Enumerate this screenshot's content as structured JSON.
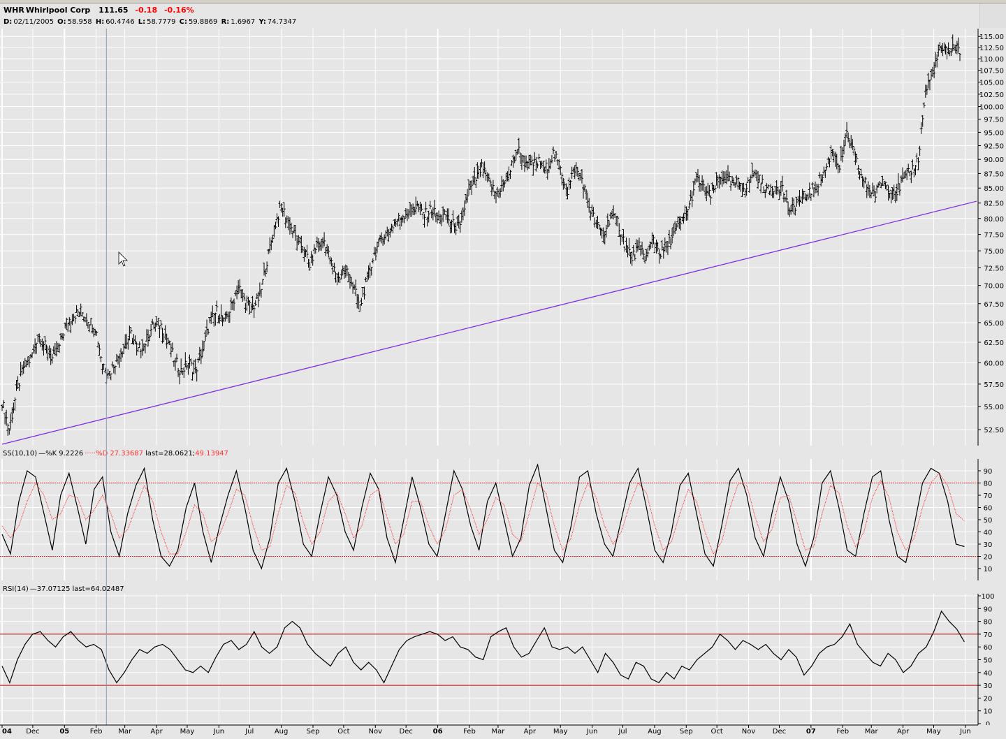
{
  "header": {
    "symbol": "WHR",
    "name": "Whirlpool Corp",
    "last": "111.65",
    "change": "-0.18",
    "change_pct": "-0.16%"
  },
  "ohlc": {
    "date_label": "D:",
    "date": "02/11/2005",
    "open_label": "O:",
    "open": "58.958",
    "high_label": "H:",
    "high": "60.4746",
    "low_label": "L:",
    "low": "58.7779",
    "close_label": "C:",
    "close": "59.8869",
    "range_label": "R:",
    "range": "1.6967",
    "y_label": "Y:",
    "y": "74.7347"
  },
  "stoch_header": {
    "name": "SS(10,10)",
    "k_label": "%K",
    "k_value": "9.2226",
    "d_label": "%D",
    "d_value": "27.33687",
    "last_label": "last=",
    "last_value": "28.0621;",
    "last_d_value": "49.13947"
  },
  "rsi_header": {
    "name": "RSI(14)",
    "value": "37.07125",
    "last_label": "last=",
    "last_value": "64.02487"
  },
  "colors": {
    "background": "#e6e6e6",
    "grid": "#ffffff",
    "price": "#000000",
    "trendline": "#7f2fdf",
    "d_line": "#ff3030",
    "rsi_band": "#c00000",
    "stoch_band": "#d02020",
    "cursor_line": "#8c9cb4"
  },
  "chart_data": [
    {
      "type": "ohlc",
      "title": "WHR Whirlpool Corp",
      "y_ticks": [
        52.5,
        55.0,
        57.5,
        60.0,
        62.5,
        65.0,
        67.5,
        70.0,
        72.5,
        75.0,
        77.5,
        80.0,
        82.5,
        85.0,
        87.5,
        90.0,
        92.5,
        95.0,
        97.5,
        100.0,
        102.5,
        105.0,
        107.5,
        110.0,
        112.5,
        115.0
      ],
      "scale": "log",
      "ylim": [
        51.0,
        116.0
      ],
      "x_labels": [
        "04",
        "Dec",
        "05",
        "Feb",
        "Mar",
        "Apr",
        "May",
        "Jun",
        "Jul",
        "Aug",
        "Sep",
        "Oct",
        "Nov",
        "Dec",
        "06",
        "Feb",
        "Mar",
        "Apr",
        "May",
        "Jun",
        "Jul",
        "Aug",
        "Sep",
        "Oct",
        "Nov",
        "Dec",
        "07",
        "Feb",
        "Mar",
        "Apr",
        "May",
        "Jun"
      ],
      "year_labels": [
        "04",
        "05",
        "06",
        "07"
      ],
      "series_close": [
        [
          "2004-11-01",
          55.5
        ],
        [
          "2004-11-08",
          52.5
        ],
        [
          "2004-11-15",
          56.5
        ],
        [
          "2004-11-22",
          59.5
        ],
        [
          "2004-11-29",
          60.5
        ],
        [
          "2004-12-06",
          63.5
        ],
        [
          "2004-12-13",
          62.0
        ],
        [
          "2004-12-20",
          60.5
        ],
        [
          "2004-12-27",
          62.0
        ],
        [
          "2005-01-03",
          65.0
        ],
        [
          "2005-01-10",
          66.0
        ],
        [
          "2005-01-17",
          66.5
        ],
        [
          "2005-01-24",
          65.5
        ],
        [
          "2005-01-31",
          64.5
        ],
        [
          "2005-02-07",
          60.0
        ],
        [
          "2005-02-14",
          58.8
        ],
        [
          "2005-02-21",
          60.5
        ],
        [
          "2005-02-28",
          62.0
        ],
        [
          "2005-03-07",
          63.5
        ],
        [
          "2005-03-14",
          61.5
        ],
        [
          "2005-03-21",
          62.5
        ],
        [
          "2005-03-28",
          64.5
        ],
        [
          "2005-04-04",
          65.0
        ],
        [
          "2005-04-11",
          63.0
        ],
        [
          "2005-04-18",
          60.5
        ],
        [
          "2005-04-25",
          59.0
        ],
        [
          "2005-05-02",
          60.0
        ],
        [
          "2005-05-09",
          59.0
        ],
        [
          "2005-05-16",
          61.5
        ],
        [
          "2005-05-23",
          65.0
        ],
        [
          "2005-05-30",
          66.5
        ],
        [
          "2005-06-06",
          65.0
        ],
        [
          "2005-06-13",
          67.0
        ],
        [
          "2005-06-20",
          70.0
        ],
        [
          "2005-06-27",
          67.5
        ],
        [
          "2005-07-04",
          67.0
        ],
        [
          "2005-07-11",
          68.5
        ],
        [
          "2005-07-18",
          73.5
        ],
        [
          "2005-07-25",
          78.5
        ],
        [
          "2005-08-01",
          82.0
        ],
        [
          "2005-08-08",
          79.5
        ],
        [
          "2005-08-15",
          77.0
        ],
        [
          "2005-08-22",
          75.5
        ],
        [
          "2005-08-29",
          73.0
        ],
        [
          "2005-09-05",
          76.0
        ],
        [
          "2005-09-12",
          76.5
        ],
        [
          "2005-09-19",
          73.0
        ],
        [
          "2005-09-26",
          71.0
        ],
        [
          "2005-10-03",
          72.5
        ],
        [
          "2005-10-10",
          70.0
        ],
        [
          "2005-10-17",
          67.0
        ],
        [
          "2005-10-24",
          71.0
        ],
        [
          "2005-10-31",
          74.5
        ],
        [
          "2005-11-07",
          77.0
        ],
        [
          "2005-11-14",
          78.0
        ],
        [
          "2005-11-21",
          79.5
        ],
        [
          "2005-11-28",
          80.5
        ],
        [
          "2005-12-05",
          81.5
        ],
        [
          "2005-12-12",
          82.0
        ],
        [
          "2005-12-19",
          80.5
        ],
        [
          "2005-12-26",
          81.5
        ],
        [
          "2006-01-02",
          80.0
        ],
        [
          "2006-01-09",
          80.5
        ],
        [
          "2006-01-16",
          79.0
        ],
        [
          "2006-01-23",
          78.5
        ],
        [
          "2006-01-30",
          84.0
        ],
        [
          "2006-02-06",
          86.0
        ],
        [
          "2006-02-13",
          88.5
        ],
        [
          "2006-02-20",
          86.0
        ],
        [
          "2006-02-27",
          84.0
        ],
        [
          "2006-03-06",
          85.5
        ],
        [
          "2006-03-13",
          88.0
        ],
        [
          "2006-03-20",
          92.0
        ],
        [
          "2006-03-27",
          89.5
        ],
        [
          "2006-04-03",
          89.0
        ],
        [
          "2006-04-10",
          89.5
        ],
        [
          "2006-04-17",
          88.5
        ],
        [
          "2006-04-24",
          91.0
        ],
        [
          "2006-05-01",
          88.5
        ],
        [
          "2006-05-08",
          84.5
        ],
        [
          "2006-05-15",
          88.5
        ],
        [
          "2006-05-22",
          86.5
        ],
        [
          "2006-05-29",
          82.0
        ],
        [
          "2006-06-05",
          79.0
        ],
        [
          "2006-06-12",
          77.5
        ],
        [
          "2006-06-19",
          80.5
        ],
        [
          "2006-06-26",
          79.5
        ],
        [
          "2006-07-03",
          76.0
        ],
        [
          "2006-07-10",
          74.0
        ],
        [
          "2006-07-17",
          75.5
        ],
        [
          "2006-07-24",
          74.0
        ],
        [
          "2006-07-31",
          77.0
        ],
        [
          "2006-08-07",
          74.5
        ],
        [
          "2006-08-14",
          76.0
        ],
        [
          "2006-08-21",
          78.0
        ],
        [
          "2006-08-28",
          79.5
        ],
        [
          "2006-09-04",
          82.0
        ],
        [
          "2006-09-11",
          86.5
        ],
        [
          "2006-09-18",
          85.0
        ],
        [
          "2006-09-25",
          83.5
        ],
        [
          "2006-10-02",
          86.5
        ],
        [
          "2006-10-09",
          87.0
        ],
        [
          "2006-10-16",
          85.5
        ],
        [
          "2006-10-23",
          86.0
        ],
        [
          "2006-10-30",
          85.0
        ],
        [
          "2006-11-06",
          88.0
        ],
        [
          "2006-11-13",
          86.0
        ],
        [
          "2006-11-20",
          84.5
        ],
        [
          "2006-11-27",
          85.5
        ],
        [
          "2006-12-04",
          85.0
        ],
        [
          "2006-12-11",
          81.0
        ],
        [
          "2006-12-18",
          82.5
        ],
        [
          "2006-12-25",
          83.5
        ],
        [
          "2007-01-01",
          84.5
        ],
        [
          "2007-01-08",
          86.0
        ],
        [
          "2007-01-15",
          88.0
        ],
        [
          "2007-01-22",
          92.0
        ],
        [
          "2007-01-29",
          88.5
        ],
        [
          "2007-02-05",
          94.5
        ],
        [
          "2007-02-12",
          91.0
        ],
        [
          "2007-02-19",
          87.0
        ],
        [
          "2007-02-26",
          85.0
        ],
        [
          "2007-03-05",
          84.0
        ],
        [
          "2007-03-12",
          86.5
        ],
        [
          "2007-03-19",
          85.0
        ],
        [
          "2007-03-26",
          84.5
        ],
        [
          "2007-04-02",
          86.5
        ],
        [
          "2007-04-09",
          88.0
        ],
        [
          "2007-04-16",
          90.0
        ],
        [
          "2007-04-23",
          103.0
        ],
        [
          "2007-04-30",
          107.0
        ],
        [
          "2007-05-07",
          112.0
        ],
        [
          "2007-05-14",
          111.5
        ],
        [
          "2007-05-21",
          113.0
        ],
        [
          "2007-05-28",
          111.65
        ]
      ],
      "trendline": {
        "from": [
          "2004-11-01",
          51.0
        ],
        "to": [
          "2007-06-12",
          82.8
        ]
      }
    },
    {
      "type": "line",
      "title": "SS(10,10)",
      "y_ticks": [
        10,
        20,
        30,
        40,
        50,
        60,
        70,
        80,
        90
      ],
      "ylim": [
        2,
        98
      ],
      "bands": [
        20,
        80
      ],
      "series": [
        {
          "name": "%K",
          "values": [
            38,
            22,
            65,
            90,
            85,
            55,
            25,
            70,
            88,
            60,
            30,
            75,
            85,
            40,
            20,
            55,
            78,
            92,
            50,
            20,
            12,
            25,
            60,
            80,
            40,
            15,
            45,
            70,
            90,
            60,
            25,
            10,
            35,
            80,
            92,
            65,
            30,
            20,
            55,
            85,
            70,
            40,
            25,
            60,
            88,
            75,
            35,
            15,
            50,
            85,
            60,
            30,
            20,
            55,
            90,
            75,
            45,
            25,
            65,
            80,
            50,
            20,
            35,
            78,
            95,
            60,
            25,
            15,
            45,
            85,
            90,
            55,
            30,
            20,
            50,
            80,
            92,
            60,
            25,
            15,
            40,
            78,
            88,
            55,
            22,
            12,
            45,
            82,
            92,
            70,
            35,
            20,
            55,
            85,
            65,
            30,
            12,
            35,
            80,
            90,
            60,
            25,
            20,
            55,
            85,
            90,
            50,
            20,
            15,
            45,
            80,
            92,
            88,
            65,
            30,
            28
          ]
        },
        {
          "name": "%D",
          "values": [
            45,
            35,
            45,
            65,
            80,
            70,
            50,
            55,
            70,
            68,
            50,
            58,
            70,
            55,
            35,
            42,
            60,
            78,
            65,
            40,
            22,
            22,
            40,
            62,
            55,
            32,
            38,
            55,
            75,
            70,
            45,
            25,
            28,
            55,
            78,
            72,
            48,
            30,
            40,
            65,
            72,
            55,
            35,
            45,
            70,
            75,
            52,
            30,
            38,
            65,
            65,
            45,
            30,
            42,
            70,
            75,
            58,
            38,
            50,
            68,
            62,
            38,
            32,
            55,
            80,
            72,
            45,
            25,
            35,
            62,
            80,
            68,
            45,
            30,
            40,
            62,
            80,
            72,
            45,
            25,
            32,
            55,
            75,
            65,
            40,
            22,
            32,
            60,
            80,
            78,
            52,
            32,
            42,
            68,
            70,
            48,
            25,
            28,
            55,
            78,
            72,
            45,
            28,
            40,
            68,
            82,
            68,
            40,
            25,
            35,
            60,
            80,
            88,
            78,
            55,
            49
          ]
        }
      ]
    },
    {
      "type": "line",
      "title": "RSI(14)",
      "y_ticks": [
        0,
        10,
        20,
        30,
        40,
        50,
        60,
        70,
        80,
        90,
        100
      ],
      "ylim": [
        0,
        100
      ],
      "bands": [
        30,
        70
      ],
      "series": [
        {
          "name": "RSI",
          "values": [
            45,
            32,
            50,
            62,
            70,
            72,
            65,
            60,
            68,
            72,
            65,
            60,
            62,
            58,
            42,
            32,
            40,
            50,
            58,
            55,
            60,
            62,
            58,
            50,
            42,
            40,
            45,
            40,
            52,
            62,
            65,
            58,
            62,
            72,
            60,
            55,
            60,
            75,
            80,
            75,
            62,
            55,
            50,
            45,
            55,
            60,
            48,
            42,
            48,
            42,
            32,
            45,
            58,
            65,
            68,
            70,
            72,
            70,
            65,
            68,
            60,
            58,
            52,
            50,
            68,
            72,
            75,
            60,
            52,
            55,
            65,
            75,
            60,
            58,
            60,
            55,
            60,
            50,
            40,
            55,
            48,
            38,
            35,
            48,
            45,
            35,
            32,
            40,
            35,
            45,
            42,
            50,
            55,
            60,
            70,
            65,
            58,
            65,
            62,
            58,
            62,
            55,
            50,
            58,
            52,
            38,
            45,
            55,
            60,
            62,
            68,
            78,
            62,
            55,
            48,
            45,
            55,
            50,
            40,
            45,
            55,
            60,
            72,
            88,
            80,
            74,
            64
          ]
        }
      ]
    }
  ]
}
